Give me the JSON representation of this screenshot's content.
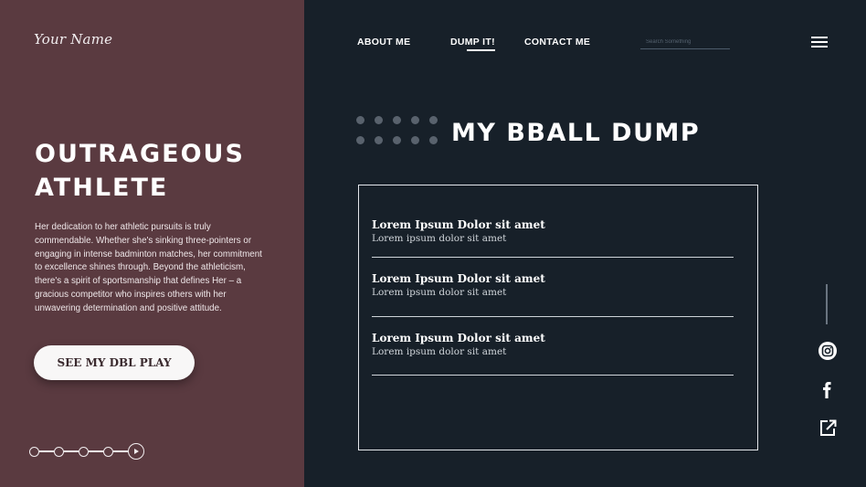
{
  "brand": {
    "logo_text": "Your Name"
  },
  "hero": {
    "title_line1": "OUTRAGEOUS",
    "title_line2": "ATHLETE",
    "description": "Her dedication to her athletic pursuits is truly commendable. Whether she's sinking three-pointers or engaging in intense badminton matches, her commitment to excellence shines through. Beyond the athleticism, there's a spirit of sportsmanship that defines Her – a gracious competitor who inspires others with her unwavering determination and positive attitude.",
    "cta_label": "SEE MY DBL PLAY"
  },
  "stepper": {
    "steps": 5,
    "current_step_icon": "play-icon"
  },
  "nav": {
    "links": [
      {
        "label": "ABOUT ME"
      },
      {
        "label": "DUMP IT!"
      },
      {
        "label": "CONTACT ME"
      }
    ],
    "active_link": "DUMP IT!",
    "search": {
      "placeholder": "Search Something",
      "value": ""
    },
    "menu_icon": "hamburger-menu-icon"
  },
  "main": {
    "title": "MY BBALL DUMP",
    "items": [
      {
        "title": "Lorem Ipsum Dolor sit amet",
        "subtitle": "Lorem ipsum dolor sit amet"
      },
      {
        "title": "Lorem Ipsum Dolor sit amet",
        "subtitle": "Lorem ipsum dolor sit amet"
      },
      {
        "title": "Lorem Ipsum Dolor sit amet",
        "subtitle": "Lorem ipsum dolor sit amet"
      }
    ]
  },
  "social": {
    "icons": [
      "instagram-icon",
      "facebook-icon",
      "external-link-icon"
    ]
  },
  "colors": {
    "left_panel": "#5a3a40",
    "right_panel": "#172029",
    "text_primary": "#ffffff",
    "dots": "#59626d"
  }
}
